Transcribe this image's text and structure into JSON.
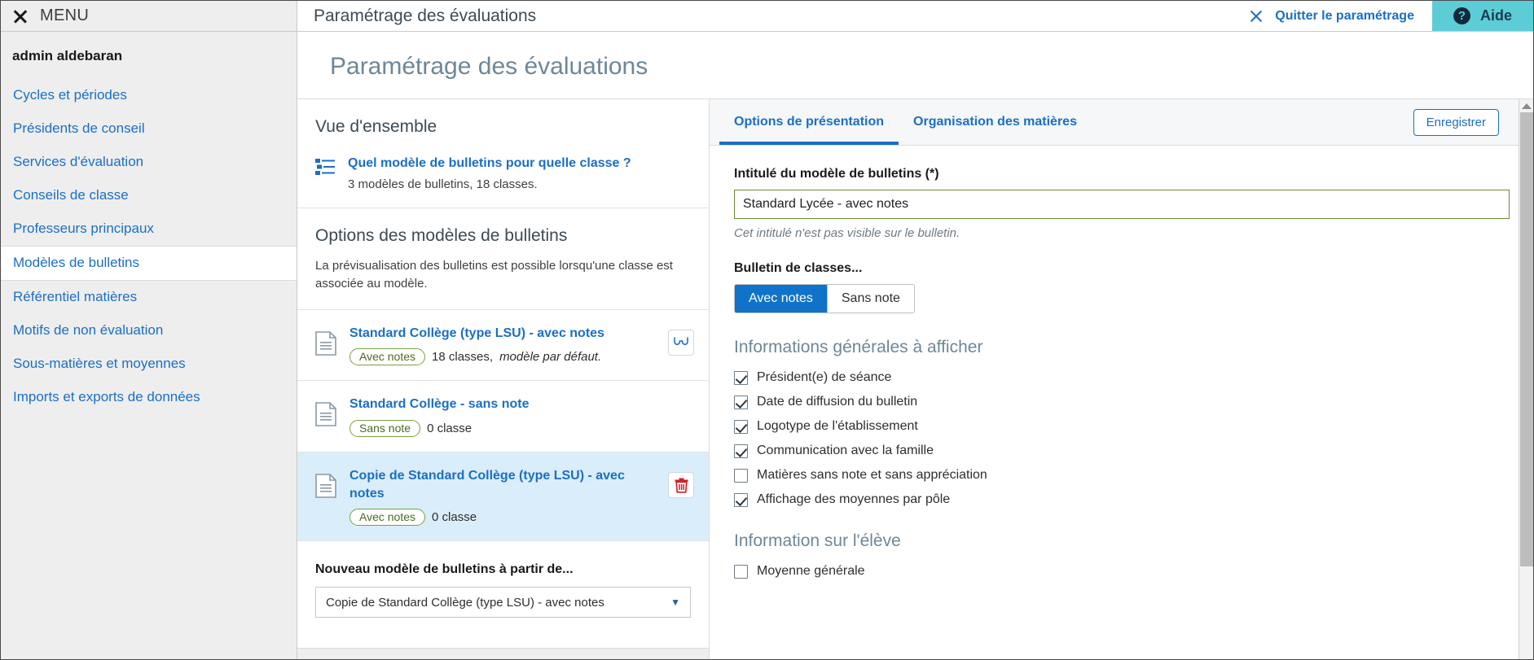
{
  "topbar": {
    "menu_label": "MENU",
    "title": "Paramétrage des évaluations",
    "quit_label": "Quitter le paramétrage",
    "aide_label": "Aide",
    "aide_glyph": "?"
  },
  "sidebar": {
    "user": "admin aldebaran",
    "items": [
      {
        "label": "Cycles et périodes",
        "active": false
      },
      {
        "label": "Présidents de conseil",
        "active": false
      },
      {
        "label": "Services d'évaluation",
        "active": false
      },
      {
        "label": "Conseils de classe",
        "active": false
      },
      {
        "label": "Professeurs principaux",
        "active": false
      },
      {
        "label": "Modèles de bulletins",
        "active": true
      },
      {
        "label": "Référentiel matières",
        "active": false
      },
      {
        "label": "Motifs de non évaluation",
        "active": false
      },
      {
        "label": "Sous-matières et moyennes",
        "active": false
      },
      {
        "label": "Imports et exports de données",
        "active": false
      }
    ]
  },
  "page": {
    "title": "Paramétrage des évaluations"
  },
  "left_panel": {
    "overview_heading": "Vue d'ensemble",
    "overview_link": "Quel modèle de bulletins pour quelle classe ?",
    "overview_sub": "3 modèles de bulletins, 18 classes.",
    "options_heading": "Options des modèles de bulletins",
    "options_desc": "La prévisualisation des bulletins est possible lorsqu'une classe est associée au modèle.",
    "models": [
      {
        "name": "Standard Collège (type LSU) - avec notes",
        "pill": "Avec notes",
        "meta": "18 classes,",
        "meta_em": "modèle par défaut.",
        "action": "preview-glasses-icon",
        "selected": false
      },
      {
        "name": "Standard Collège - sans note",
        "pill": "Sans note",
        "meta": "0 classe",
        "meta_em": "",
        "action": "",
        "selected": false
      },
      {
        "name": "Copie de Standard Collège (type LSU) - avec notes",
        "pill": "Avec notes",
        "meta": "0 classe",
        "meta_em": "",
        "action": "delete-trash-icon",
        "selected": true
      }
    ],
    "new_model_label": "Nouveau modèle de bulletins à partir de...",
    "new_model_value": "Copie de Standard Collège (type LSU) - avec notes"
  },
  "right_panel": {
    "tabs": [
      {
        "label": "Options de présentation",
        "active": true
      },
      {
        "label": "Organisation des matières",
        "active": false
      }
    ],
    "save_label": "Enregistrer",
    "title_field_label": "Intitulé du modèle de bulletins (*)",
    "title_field_value": "Standard Lycée - avec notes",
    "title_field_hint": "Cet intitulé n'est pas visible sur le bulletin.",
    "bulletin_label": "Bulletin de classes...",
    "bulletin_options": [
      {
        "label": "Avec notes",
        "selected": true
      },
      {
        "label": "Sans note",
        "selected": false
      }
    ],
    "general_heading": "Informations générales à afficher",
    "general_checkboxes": [
      {
        "label": "Président(e) de séance",
        "checked": true
      },
      {
        "label": "Date de diffusion du bulletin",
        "checked": true
      },
      {
        "label": "Logotype de l'établissement",
        "checked": true
      },
      {
        "label": "Communication avec la famille",
        "checked": true
      },
      {
        "label": "Matières sans note et sans appréciation",
        "checked": false
      },
      {
        "label": "Affichage des moyennes par pôle",
        "checked": true
      }
    ],
    "student_heading": "Information sur l'élève",
    "student_checkboxes": [
      {
        "label": "Moyenne générale",
        "checked": false
      }
    ]
  },
  "colors": {
    "accent_blue": "#1b6fc4",
    "active_blue": "#1072c8",
    "aide_teal": "#5ccdd6",
    "pill_green": "#7aa23c",
    "selected_row": "#daedfb",
    "danger_red": "#d32027",
    "title_slate": "#6e8799"
  }
}
